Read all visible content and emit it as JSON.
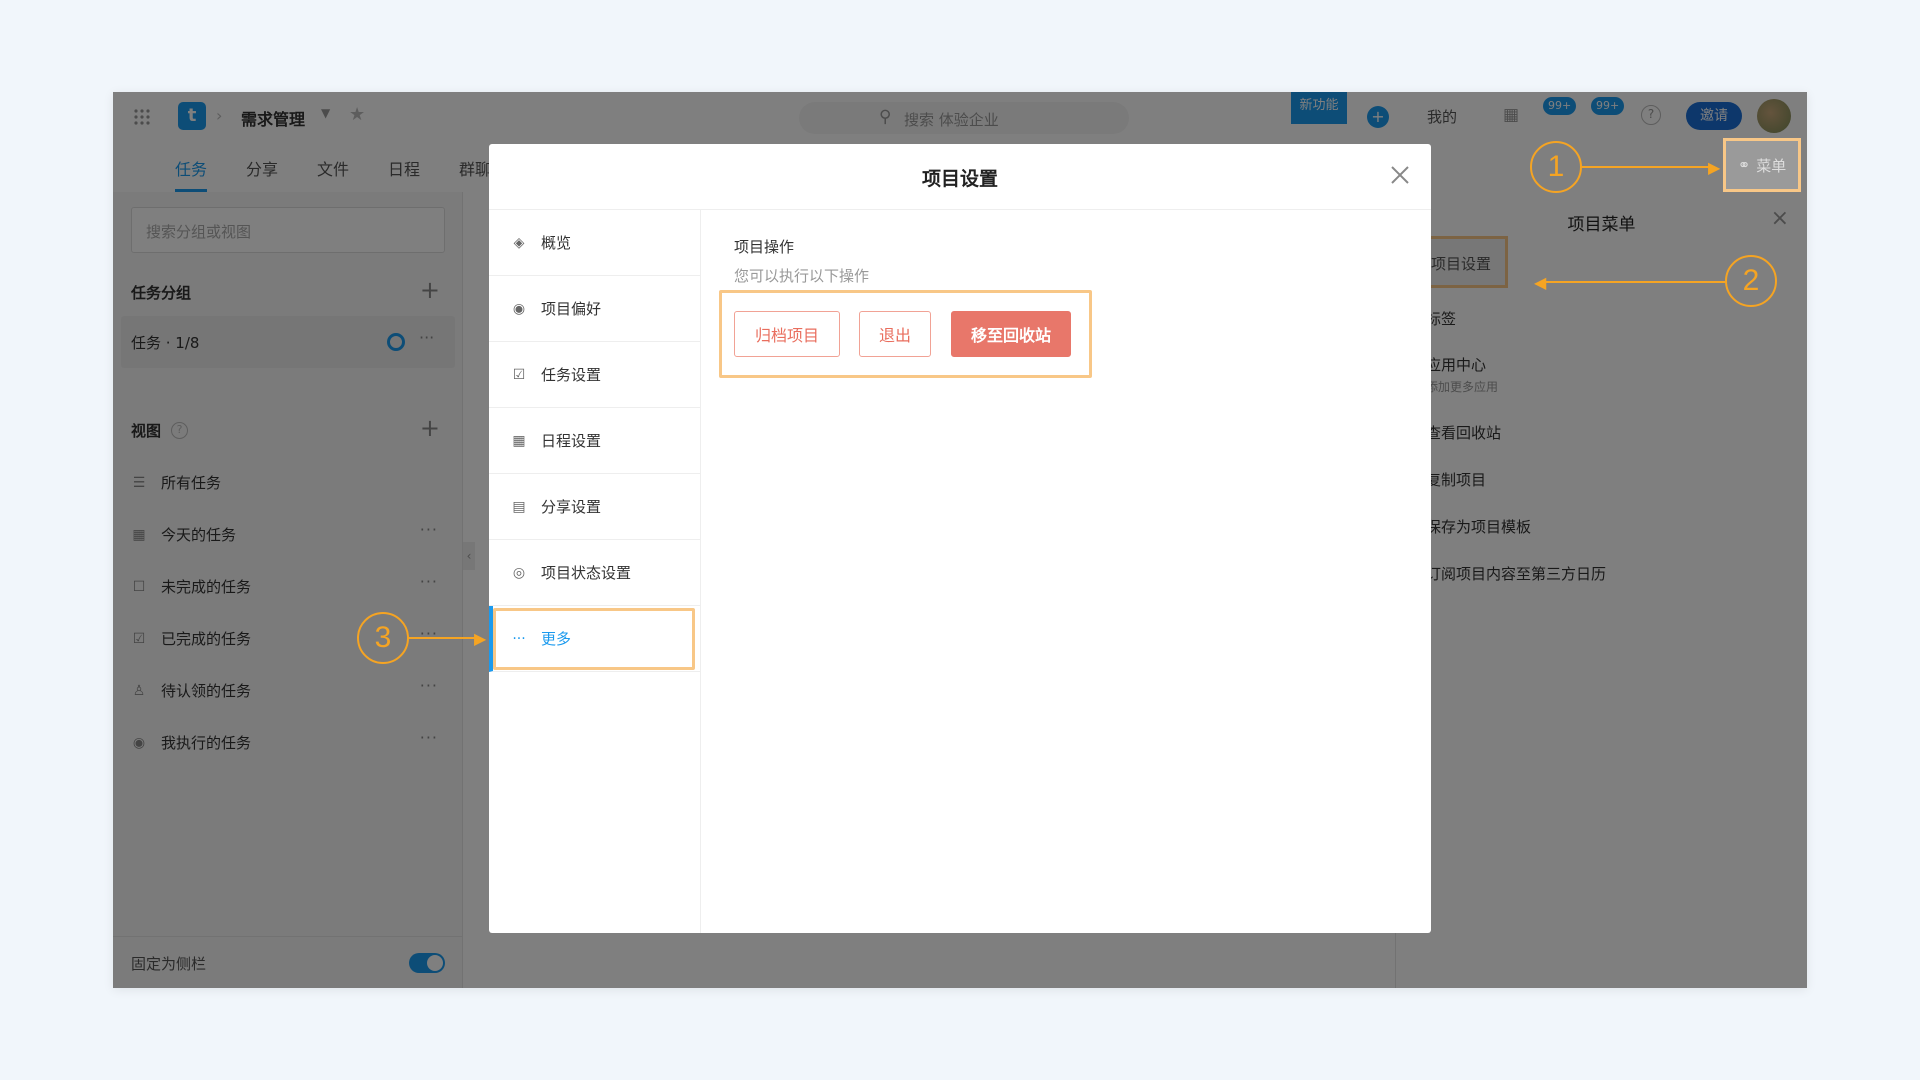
{
  "topbar": {
    "project_name": "需求管理",
    "search_placeholder": "搜索 体验企业",
    "new_feature_badge": "新功能",
    "mine_label": "我的",
    "badge_count_1": "99+",
    "badge_count_2": "99+",
    "invite_label": "邀请",
    "menu_label": "菜单"
  },
  "tabs": [
    "任务",
    "分享",
    "文件",
    "日程",
    "群聊"
  ],
  "sidebar": {
    "search_placeholder": "搜索分组或视图",
    "groups_title": "任务分组",
    "group_item": "任务 · 1/8",
    "views_title": "视图",
    "views": [
      {
        "label": "所有任务",
        "icon": "list-icon"
      },
      {
        "label": "今天的任务",
        "icon": "calendar-icon"
      },
      {
        "label": "未完成的任务",
        "icon": "checkbox-empty-icon"
      },
      {
        "label": "已完成的任务",
        "icon": "checkbox-checked-icon"
      },
      {
        "label": "待认领的任务",
        "icon": "user-icon"
      },
      {
        "label": "我执行的任务",
        "icon": "user-circle-icon"
      }
    ],
    "pin_label": "固定为侧栏"
  },
  "right_panel": {
    "title": "项目菜单",
    "items": [
      {
        "label": "项目设置"
      },
      {
        "label": "标签"
      },
      {
        "label": "应用中心",
        "sub": "添加更多应用"
      },
      {
        "label": "查看回收站"
      },
      {
        "label": "复制项目"
      },
      {
        "label": "保存为项目模板"
      },
      {
        "label": "订阅项目内容至第三方日历"
      }
    ]
  },
  "modal": {
    "title": "项目设置",
    "nav": [
      {
        "label": "概览",
        "icon": "layers-icon"
      },
      {
        "label": "项目偏好",
        "icon": "eye-icon"
      },
      {
        "label": "任务设置",
        "icon": "checkbox-icon"
      },
      {
        "label": "日程设置",
        "icon": "calendar-icon"
      },
      {
        "label": "分享设置",
        "icon": "document-icon"
      },
      {
        "label": "项目状态设置",
        "icon": "status-icon"
      },
      {
        "label": "更多",
        "icon": "more-icon"
      }
    ],
    "section_title": "项目操作",
    "section_desc": "您可以执行以下操作",
    "archive_button": "归档项目",
    "quit_button": "退出",
    "trash_button": "移至回收站"
  },
  "callouts": [
    "1",
    "2",
    "3"
  ],
  "colors": {
    "accent": "#1b9aee",
    "danger": "#e8776a",
    "callout": "#f5a423"
  }
}
